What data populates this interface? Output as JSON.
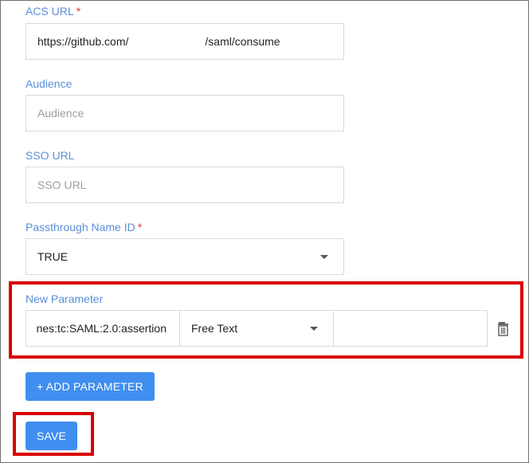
{
  "acs": {
    "label": "ACS URL",
    "required_mark": "*",
    "value_prefix": "https://github.com/",
    "value_suffix": "⁠/saml/consume"
  },
  "audience": {
    "label": "Audience",
    "placeholder": "Audience"
  },
  "sso": {
    "label": "SSO URL",
    "placeholder": "SSO URL"
  },
  "passthrough": {
    "label": "Passthrough Name ID",
    "required_mark": "*",
    "value": "TRUE"
  },
  "new_parameter": {
    "label": "New Parameter",
    "name_value": "nes:tc:SAML:2.0:assertion",
    "type_value": "Free Text",
    "value": ""
  },
  "buttons": {
    "add_parameter": "+ ADD PARAMETER",
    "save": "SAVE"
  },
  "icons": {
    "delete": "trash-icon",
    "dropdown": "chevron-down-icon"
  },
  "colors": {
    "label": "#5b8fd6",
    "required": "#e53935",
    "button": "#3f8ef0",
    "highlight": "#d90000"
  }
}
